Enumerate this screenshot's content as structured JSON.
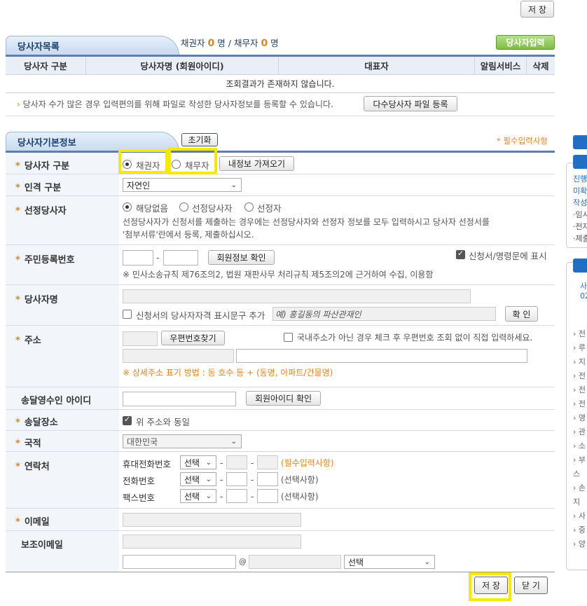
{
  "top": {
    "save_label": "저 장"
  },
  "party_list": {
    "title": "당사자목록",
    "counts": {
      "creditor_label": "채권자",
      "creditor_count": "0",
      "debtor_label": "채무자",
      "debtor_count": "0",
      "unit": "명",
      "sep": "/"
    },
    "add_button": "당사자입력",
    "columns": [
      "당사자 구분",
      "당사자명 (회원아이디)",
      "대표자",
      "알림서비스",
      "삭제"
    ],
    "empty_message": "조회결과가 존재하지 않습니다.",
    "notice": "당사자 수가 많은 경우 입력편의를 위해 파일로 작성한 당사자정보를 등록할 수 있습니다.",
    "bulk_button": "다수당사자 파일 등록"
  },
  "basic_info": {
    "title": "당사자기본정보",
    "reset_button": "초기화",
    "required_note": "* 필수입력사항",
    "party_type": {
      "label": "당사자 구분",
      "opt_creditor": "채권자",
      "opt_debtor": "채무자",
      "load_button": "내정보 가져오기"
    },
    "person_type": {
      "label": "인격 구분",
      "value": "자연인"
    },
    "designated": {
      "label": "선정당사자",
      "opt1": "해당없음",
      "opt2": "선정당사자",
      "opt3": "선정자",
      "desc1": "선정당사자가 신청서를 제출하는 경우에는 선정당사자와 선정자 정보를 모두 입력하시고 당사자 선정서를",
      "desc2": "'첨부서류'란에서 등록, 제출하십시오."
    },
    "rrn": {
      "label": "주민등록번호",
      "dash": "-",
      "verify_button": "회원정보 확인",
      "show_label": "신청서/명령문에 표시",
      "note": "※ 민사소송규칙 제76조의2, 법원 재판사무 처리규칙 제5조의2에 근거하여 수집, 이용함"
    },
    "name": {
      "label": "당사자명",
      "check_label": "신청서의 당사자자격 표시문구 추가",
      "example_placeholder": "예) 홍길동의 파산관재인",
      "confirm_button": "확 인"
    },
    "address": {
      "label": "주소",
      "zip_button": "우편번호찾기",
      "foreign_label": "국내주소가 아닌 경우 체크 후 우편번호 조회 없이 직접 입력하세요.",
      "hint": "※ 상세주소 표기 방법 : 동 호수 등 + (동명, 아파트/건물명)"
    },
    "receiver_id": {
      "label": "송달영수인 아이디",
      "verify_button": "회원아이디 확인"
    },
    "delivery": {
      "label": "송달장소",
      "same_label": "위 주소와 동일"
    },
    "nationality": {
      "label": "국적",
      "value": "대한민국"
    },
    "contact": {
      "label": "연락처",
      "mobile_label": "휴대전화번호",
      "phone_label": "전화번호",
      "fax_label": "팩스번호",
      "select_value": "선택",
      "dash": "-",
      "mobile_note": "(필수입력사항)",
      "optional_note": "(선택사항)"
    },
    "email": {
      "label": "이메일"
    },
    "sub_email": {
      "label": "보조이메일",
      "at": "@",
      "domain_select": "선택"
    }
  },
  "bottom": {
    "save_label": "저 장",
    "close_label": "닫 기"
  },
  "sidebar": {
    "lines_a": [
      "진행",
      "미확",
      "작성",
      "·임시",
      "·전자",
      "·제출"
    ],
    "lines_b": [
      "사",
      "02"
    ],
    "lines_c": [
      "› 전",
      "› 루",
      "› 지",
      "› 전",
      "› 전",
      "› 전",
      "› 영",
      "› 관",
      "› 소",
      "› 부",
      "스",
      "› 손",
      "지",
      "› 사",
      "› 중",
      "› 양"
    ]
  }
}
